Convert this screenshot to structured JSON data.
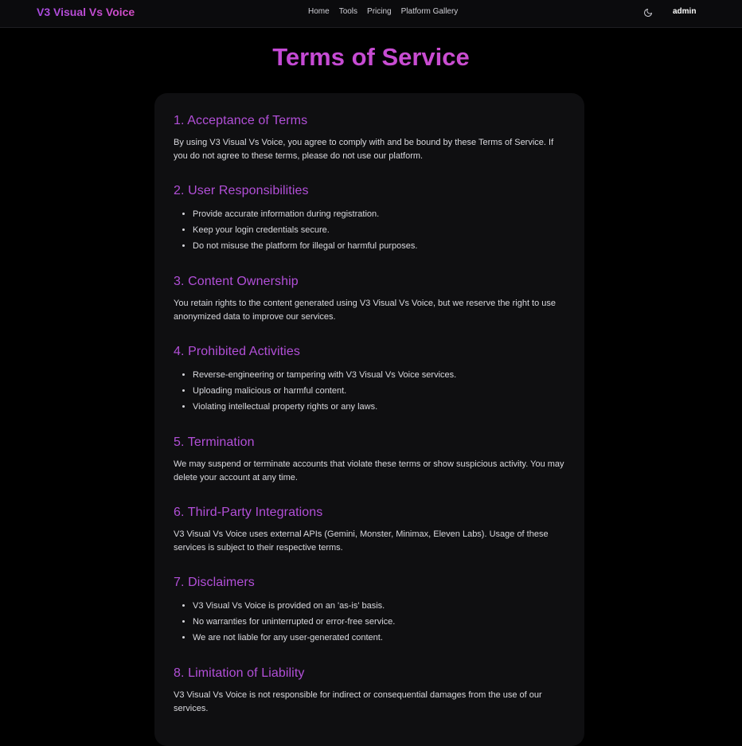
{
  "nav": {
    "brand": "V3 Visual Vs Voice",
    "links": [
      "Home",
      "Tools",
      "Pricing",
      "Platform Gallery"
    ],
    "theme_icon": "moon-icon",
    "user": "admin"
  },
  "page": {
    "title": "Terms of Service"
  },
  "sections": [
    {
      "heading": "1. Acceptance of Terms",
      "text": "By using V3 Visual Vs Voice, you agree to comply with and be bound by these Terms of Service. If you do not agree to these terms, please do not use our platform."
    },
    {
      "heading": "2. User Responsibilities",
      "items": [
        "Provide accurate information during registration.",
        "Keep your login credentials secure.",
        "Do not misuse the platform for illegal or harmful purposes."
      ]
    },
    {
      "heading": "3. Content Ownership",
      "text": "You retain rights to the content generated using V3 Visual Vs Voice, but we reserve the right to use anonymized data to improve our services."
    },
    {
      "heading": "4. Prohibited Activities",
      "items": [
        "Reverse-engineering or tampering with V3 Visual Vs Voice services.",
        "Uploading malicious or harmful content.",
        "Violating intellectual property rights or any laws."
      ]
    },
    {
      "heading": "5. Termination",
      "text": "We may suspend or terminate accounts that violate these terms or show suspicious activity. You may delete your account at any time."
    },
    {
      "heading": "6. Third-Party Integrations",
      "text": "V3 Visual Vs Voice uses external APIs (Gemini, Monster, Minimax, Eleven Labs). Usage of these services is subject to their respective terms."
    },
    {
      "heading": "7. Disclaimers",
      "items": [
        "V3 Visual Vs Voice is provided on an 'as-is' basis.",
        "No warranties for uninterrupted or error-free service.",
        "We are not liable for any user-generated content."
      ]
    },
    {
      "heading": "8. Limitation of Liability",
      "text": "V3 Visual Vs Voice is not responsible for indirect or consequential damages from the use of our services."
    }
  ]
}
